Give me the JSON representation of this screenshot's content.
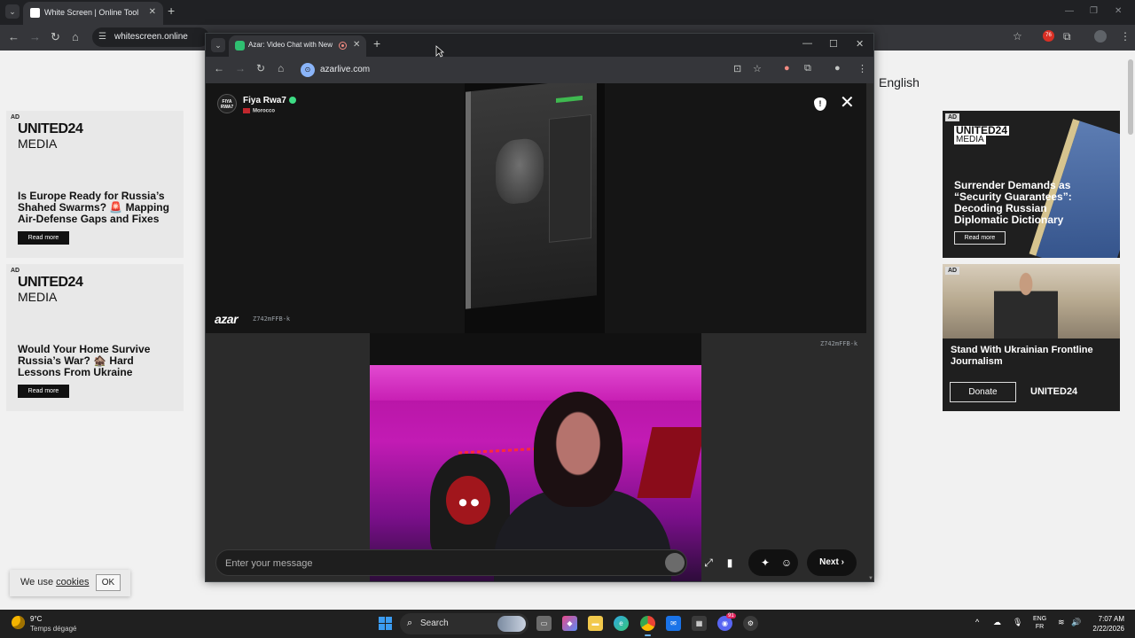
{
  "back_browser": {
    "tab_title": "White Screen | Online Tool",
    "url": "whitescreen.online",
    "extension_badge": "76"
  },
  "page": {
    "language": "English",
    "ads_left": [
      {
        "tag": "AD",
        "brand_top": "UNITED24",
        "brand_bottom": "MEDIA",
        "headline": "Is Europe Ready for Russia’s Shahed Swarms? 🚨 Mapping Air-Defense Gaps and Fixes",
        "cta": "Read more"
      },
      {
        "tag": "AD",
        "brand_top": "UNITED24",
        "brand_bottom": "MEDIA",
        "headline": "Would Your Home Survive Russia’s War? 🏚️ Hard Lessons From Ukraine",
        "cta": "Read more"
      }
    ],
    "ads_right": [
      {
        "tag": "AD",
        "brand_top": "UNITED24",
        "brand_bottom": "MEDIA",
        "headline": "Surrender Demands as “Security Guarantees”: Decoding Russian Diplomatic Dictionary",
        "cta": "Read more"
      },
      {
        "tag": "AD",
        "headline": "Stand With Ukrainian Frontline Journalism",
        "cta": "Donate",
        "brand": "UNITED24"
      }
    ],
    "cookie": {
      "prefix": "We use ",
      "link": "cookies",
      "ok": "OK"
    }
  },
  "front_browser": {
    "tab_title": "Azar: Video Chat with New",
    "url": "azarlive.com"
  },
  "azar": {
    "partner": {
      "avatar_text": "FIYA RWA7",
      "name": "Fiya Rwa7",
      "country": "Morocco"
    },
    "logo": "azar",
    "remote_id": "Z742mFFB-k",
    "local_id": "Z742mFFB-k",
    "message_placeholder": "Enter your message",
    "next_label": "Next"
  },
  "taskbar": {
    "temperature": "9°C",
    "weather": "Temps dégagé",
    "search_label": "Search",
    "discord_badge": "91",
    "lang_top": "ENG",
    "lang_bottom": "FR",
    "time": "7:07 AM",
    "date": "2/22/2026"
  },
  "colors": {
    "accent_green": "#2fbf71",
    "verified_badge": "#3ddc84",
    "taskbar": "#202020"
  }
}
